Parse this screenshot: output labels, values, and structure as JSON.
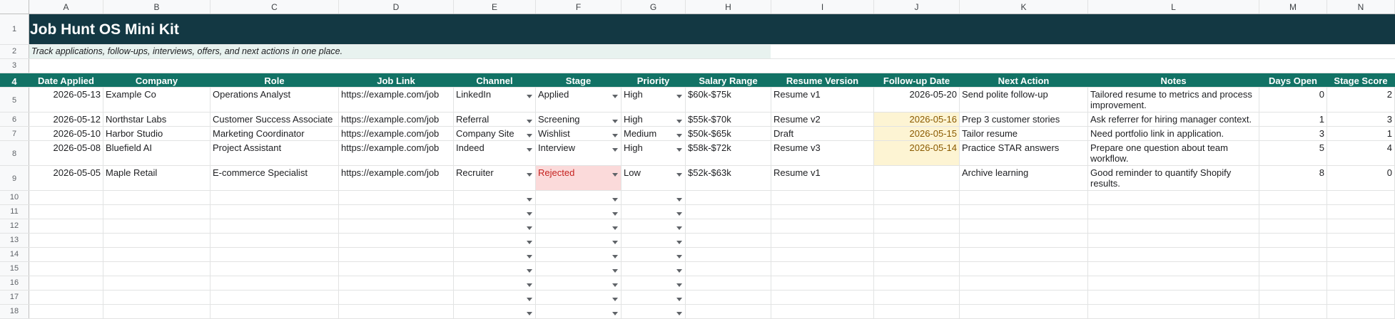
{
  "columns": [
    "A",
    "B",
    "C",
    "D",
    "E",
    "F",
    "G",
    "H",
    "I",
    "J",
    "K",
    "L",
    "M",
    "N"
  ],
  "row_numbers": [
    "1",
    "2",
    "3",
    "4",
    "5",
    "6",
    "7",
    "8",
    "9",
    "10",
    "11",
    "12",
    "13",
    "14",
    "15",
    "16",
    "17",
    "18"
  ],
  "title": "Job Hunt OS Mini Kit",
  "subtitle": "Track applications, follow-ups, interviews, offers, and next actions in one place.",
  "headers": [
    "Date Applied",
    "Company",
    "Role",
    "Job Link",
    "Channel",
    "Stage",
    "Priority",
    "Salary Range",
    "Resume Version",
    "Follow-up Date",
    "Next Action",
    "Notes",
    "Days Open",
    "Stage Score"
  ],
  "rows": [
    {
      "date": "2026-05-13",
      "company": "Example Co",
      "role": "Operations Analyst",
      "link": "https://example.com/job",
      "channel": "LinkedIn",
      "stage": "Applied",
      "priority": "High",
      "salary": "$60k-$75k",
      "resume": "Resume v1",
      "followup": "2026-05-20",
      "next": "Send polite follow-up",
      "notes": "Tailored resume to metrics and process improvement.",
      "days": "0",
      "score": "2"
    },
    {
      "date": "2026-05-12",
      "company": "Northstar Labs",
      "role": "Customer Success Associate",
      "link": "https://example.com/job",
      "channel": "Referral",
      "stage": "Screening",
      "priority": "High",
      "salary": "$55k-$70k",
      "resume": "Resume v2",
      "followup": "2026-05-16",
      "next": "Prep 3 customer stories",
      "notes": "Ask referrer for hiring manager context.",
      "days": "1",
      "score": "3"
    },
    {
      "date": "2026-05-10",
      "company": "Harbor Studio",
      "role": "Marketing Coordinator",
      "link": "https://example.com/job",
      "channel": "Company Site",
      "stage": "Wishlist",
      "priority": "Medium",
      "salary": "$50k-$65k",
      "resume": "Draft",
      "followup": "2026-05-15",
      "next": "Tailor resume",
      "notes": "Need portfolio link in application.",
      "days": "3",
      "score": "1"
    },
    {
      "date": "2026-05-08",
      "company": "Bluefield AI",
      "role": "Project Assistant",
      "link": "https://example.com/job",
      "channel": "Indeed",
      "stage": "Interview",
      "priority": "High",
      "salary": "$58k-$72k",
      "resume": "Resume v3",
      "followup": "2026-05-14",
      "next": "Practice STAR answers",
      "notes": "Prepare one question about team workflow.",
      "days": "5",
      "score": "4"
    },
    {
      "date": "2026-05-05",
      "company": "Maple Retail",
      "role": "E-commerce Specialist",
      "link": "https://example.com/job",
      "channel": "Recruiter",
      "stage": "Rejected",
      "priority": "Low",
      "salary": "$52k-$63k",
      "resume": "Resume v1",
      "followup": "",
      "next": "Archive learning",
      "notes": "Good reminder to quantify Shopify results.",
      "days": "8",
      "score": "0"
    }
  ],
  "colors": {
    "title_bg": "#133843",
    "header_bg": "#127265",
    "subtitle_bg": "#e8f2ef",
    "followup_highlight": "#fdf4d3",
    "rejected_highlight": "#fbdada"
  }
}
